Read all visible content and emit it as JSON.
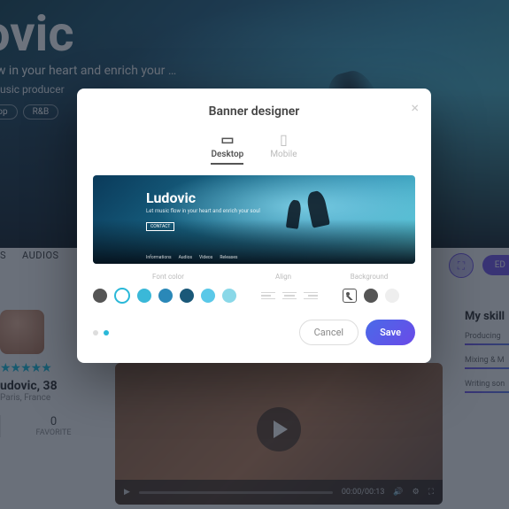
{
  "hero": {
    "title": "ovic",
    "subtitle": "flow in your heart and enrich your …",
    "role": "a music producer",
    "genres": [
      "Pop",
      "R&B"
    ]
  },
  "tabs": [
    "S",
    "AUDIOS"
  ],
  "profile": {
    "name": "udovic, 38",
    "location": "Paris, France",
    "stars": "★★★★★",
    "fav_count": "0",
    "fav_label": "FAVORITE"
  },
  "video": {
    "time": "00:00/00:13"
  },
  "skills": {
    "heading": "My skill",
    "items": [
      "Producing",
      "Mixing & M",
      "Writing son"
    ]
  },
  "edit_label": "ED",
  "modal": {
    "title": "Banner designer",
    "close": "×",
    "devices": [
      {
        "label": "Desktop",
        "icon": "▭",
        "active": true
      },
      {
        "label": "Mobile",
        "icon": "▯",
        "active": false
      }
    ],
    "preview": {
      "title": "Ludovic",
      "subtitle": "Let music flow in your heart and enrich your soul",
      "button": "CONTACT",
      "nav": [
        "Informations",
        "Audios",
        "Videos",
        "Releases"
      ]
    },
    "section_labels": [
      "Font color",
      "Align",
      "Background"
    ],
    "font_colors": [
      "#555555",
      "#ffffff",
      "#3ab8d8",
      "#2a88b8",
      "#1a5878",
      "#5ac8e8",
      "#8ad8e8"
    ],
    "selected_color_index": 1,
    "bg_colors": [
      "#555555",
      "#eeeeee"
    ],
    "pager": {
      "count": 2,
      "active": 1
    },
    "cancel": "Cancel",
    "save": "Save"
  }
}
